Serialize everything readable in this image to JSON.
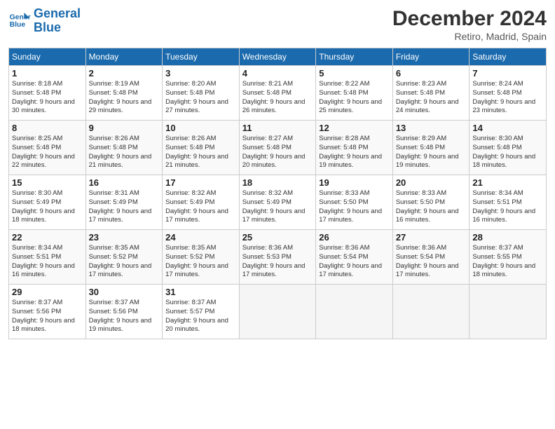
{
  "header": {
    "logo_line1": "General",
    "logo_line2": "Blue",
    "month": "December 2024",
    "location": "Retiro, Madrid, Spain"
  },
  "days_of_week": [
    "Sunday",
    "Monday",
    "Tuesday",
    "Wednesday",
    "Thursday",
    "Friday",
    "Saturday"
  ],
  "weeks": [
    [
      {
        "num": "1",
        "info": "Sunrise: 8:18 AM\nSunset: 5:48 PM\nDaylight: 9 hours and 30 minutes."
      },
      {
        "num": "2",
        "info": "Sunrise: 8:19 AM\nSunset: 5:48 PM\nDaylight: 9 hours and 29 minutes."
      },
      {
        "num": "3",
        "info": "Sunrise: 8:20 AM\nSunset: 5:48 PM\nDaylight: 9 hours and 27 minutes."
      },
      {
        "num": "4",
        "info": "Sunrise: 8:21 AM\nSunset: 5:48 PM\nDaylight: 9 hours and 26 minutes."
      },
      {
        "num": "5",
        "info": "Sunrise: 8:22 AM\nSunset: 5:48 PM\nDaylight: 9 hours and 25 minutes."
      },
      {
        "num": "6",
        "info": "Sunrise: 8:23 AM\nSunset: 5:48 PM\nDaylight: 9 hours and 24 minutes."
      },
      {
        "num": "7",
        "info": "Sunrise: 8:24 AM\nSunset: 5:48 PM\nDaylight: 9 hours and 23 minutes."
      }
    ],
    [
      {
        "num": "8",
        "info": "Sunrise: 8:25 AM\nSunset: 5:48 PM\nDaylight: 9 hours and 22 minutes."
      },
      {
        "num": "9",
        "info": "Sunrise: 8:26 AM\nSunset: 5:48 PM\nDaylight: 9 hours and 21 minutes."
      },
      {
        "num": "10",
        "info": "Sunrise: 8:26 AM\nSunset: 5:48 PM\nDaylight: 9 hours and 21 minutes."
      },
      {
        "num": "11",
        "info": "Sunrise: 8:27 AM\nSunset: 5:48 PM\nDaylight: 9 hours and 20 minutes."
      },
      {
        "num": "12",
        "info": "Sunrise: 8:28 AM\nSunset: 5:48 PM\nDaylight: 9 hours and 19 minutes."
      },
      {
        "num": "13",
        "info": "Sunrise: 8:29 AM\nSunset: 5:48 PM\nDaylight: 9 hours and 19 minutes."
      },
      {
        "num": "14",
        "info": "Sunrise: 8:30 AM\nSunset: 5:48 PM\nDaylight: 9 hours and 18 minutes."
      }
    ],
    [
      {
        "num": "15",
        "info": "Sunrise: 8:30 AM\nSunset: 5:49 PM\nDaylight: 9 hours and 18 minutes."
      },
      {
        "num": "16",
        "info": "Sunrise: 8:31 AM\nSunset: 5:49 PM\nDaylight: 9 hours and 17 minutes."
      },
      {
        "num": "17",
        "info": "Sunrise: 8:32 AM\nSunset: 5:49 PM\nDaylight: 9 hours and 17 minutes."
      },
      {
        "num": "18",
        "info": "Sunrise: 8:32 AM\nSunset: 5:49 PM\nDaylight: 9 hours and 17 minutes."
      },
      {
        "num": "19",
        "info": "Sunrise: 8:33 AM\nSunset: 5:50 PM\nDaylight: 9 hours and 17 minutes."
      },
      {
        "num": "20",
        "info": "Sunrise: 8:33 AM\nSunset: 5:50 PM\nDaylight: 9 hours and 16 minutes."
      },
      {
        "num": "21",
        "info": "Sunrise: 8:34 AM\nSunset: 5:51 PM\nDaylight: 9 hours and 16 minutes."
      }
    ],
    [
      {
        "num": "22",
        "info": "Sunrise: 8:34 AM\nSunset: 5:51 PM\nDaylight: 9 hours and 16 minutes."
      },
      {
        "num": "23",
        "info": "Sunrise: 8:35 AM\nSunset: 5:52 PM\nDaylight: 9 hours and 17 minutes."
      },
      {
        "num": "24",
        "info": "Sunrise: 8:35 AM\nSunset: 5:52 PM\nDaylight: 9 hours and 17 minutes."
      },
      {
        "num": "25",
        "info": "Sunrise: 8:36 AM\nSunset: 5:53 PM\nDaylight: 9 hours and 17 minutes."
      },
      {
        "num": "26",
        "info": "Sunrise: 8:36 AM\nSunset: 5:54 PM\nDaylight: 9 hours and 17 minutes."
      },
      {
        "num": "27",
        "info": "Sunrise: 8:36 AM\nSunset: 5:54 PM\nDaylight: 9 hours and 17 minutes."
      },
      {
        "num": "28",
        "info": "Sunrise: 8:37 AM\nSunset: 5:55 PM\nDaylight: 9 hours and 18 minutes."
      }
    ],
    [
      {
        "num": "29",
        "info": "Sunrise: 8:37 AM\nSunset: 5:56 PM\nDaylight: 9 hours and 18 minutes."
      },
      {
        "num": "30",
        "info": "Sunrise: 8:37 AM\nSunset: 5:56 PM\nDaylight: 9 hours and 19 minutes."
      },
      {
        "num": "31",
        "info": "Sunrise: 8:37 AM\nSunset: 5:57 PM\nDaylight: 9 hours and 20 minutes."
      },
      null,
      null,
      null,
      null
    ]
  ]
}
